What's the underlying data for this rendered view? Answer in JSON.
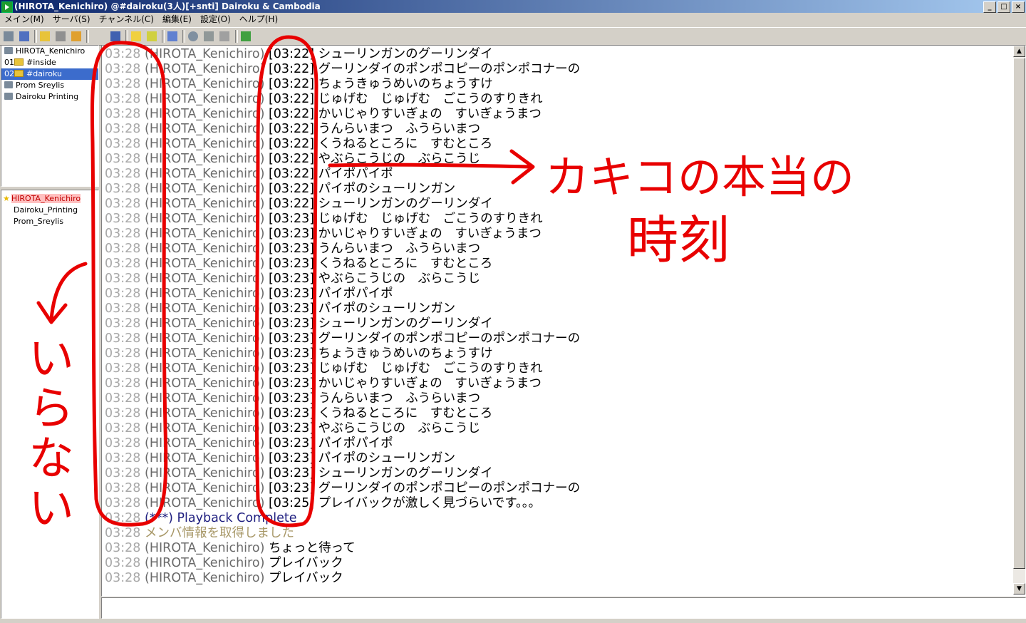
{
  "window": {
    "title": "(HIROTA_Kenichiro) @#dairoku(3人)[+snti] Dairoku & Cambodia",
    "controls": [
      "_",
      "□",
      "×"
    ]
  },
  "menu": [
    "メイン(M)",
    "サーバ(S)",
    "チャンネル(C)",
    "編集(E)",
    "設定(O)",
    "ヘルプ(H)"
  ],
  "channels": [
    {
      "num": "",
      "name": "HIROTA_Kenichiro",
      "kind": "server",
      "selected": false
    },
    {
      "num": "01",
      "name": "#inside",
      "kind": "channel",
      "selected": false
    },
    {
      "num": "02",
      "name": "#dairoku",
      "kind": "channel",
      "selected": true
    },
    {
      "num": "",
      "name": "Prom Sreylis",
      "kind": "server",
      "selected": false
    },
    {
      "num": "",
      "name": "Dairoku Printing",
      "kind": "server",
      "selected": false
    }
  ],
  "users": [
    {
      "name": "HIROTA_Kenichiro",
      "op": true
    },
    {
      "name": "Dairoku_Printing",
      "op": false
    },
    {
      "name": "Prom_Sreylis",
      "op": false
    }
  ],
  "log": [
    {
      "time": "03:28",
      "nick": "(HIROTA_Kenichiro)",
      "text": " [03:22] シューリンガンのグーリンダイ"
    },
    {
      "time": "03:28",
      "nick": "(HIROTA_Kenichiro)",
      "text": " [03:22] グーリンダイのポンポコピーのポンポコナーの"
    },
    {
      "time": "03:28",
      "nick": "(HIROTA_Kenichiro)",
      "text": " [03:22] ちょうきゅうめいのちょうすけ"
    },
    {
      "time": "03:28",
      "nick": "(HIROTA_Kenichiro)",
      "text": " [03:22] じゅげむ　じゅげむ　ごこうのすりきれ"
    },
    {
      "time": "03:28",
      "nick": "(HIROTA_Kenichiro)",
      "text": " [03:22] かいじゃりすいぎょの　すいぎょうまつ"
    },
    {
      "time": "03:28",
      "nick": "(HIROTA_Kenichiro)",
      "text": " [03:22] うんらいまつ　ふうらいまつ"
    },
    {
      "time": "03:28",
      "nick": "(HIROTA_Kenichiro)",
      "text": " [03:22] くうねるところに　すむところ"
    },
    {
      "time": "03:28",
      "nick": "(HIROTA_Kenichiro)",
      "text": " [03:22] やぶらこうじの　ぶらこうじ"
    },
    {
      "time": "03:28",
      "nick": "(HIROTA_Kenichiro)",
      "text": " [03:22] パイポパイポ"
    },
    {
      "time": "03:28",
      "nick": "(HIROTA_Kenichiro)",
      "text": " [03:22] パイポのシューリンガン"
    },
    {
      "time": "03:28",
      "nick": "(HIROTA_Kenichiro)",
      "text": " [03:22] シューリンガンのグーリンダイ"
    },
    {
      "time": "03:28",
      "nick": "(HIROTA_Kenichiro)",
      "text": " [03:23] じゅげむ　じゅげむ　ごこうのすりきれ"
    },
    {
      "time": "03:28",
      "nick": "(HIROTA_Kenichiro)",
      "text": " [03:23] かいじゃりすいぎょの　すいぎょうまつ"
    },
    {
      "time": "03:28",
      "nick": "(HIROTA_Kenichiro)",
      "text": " [03:23] うんらいまつ　ふうらいまつ"
    },
    {
      "time": "03:28",
      "nick": "(HIROTA_Kenichiro)",
      "text": " [03:23] くうねるところに　すむところ"
    },
    {
      "time": "03:28",
      "nick": "(HIROTA_Kenichiro)",
      "text": " [03:23] やぶらこうじの　ぶらこうじ"
    },
    {
      "time": "03:28",
      "nick": "(HIROTA_Kenichiro)",
      "text": " [03:23] パイポパイポ"
    },
    {
      "time": "03:28",
      "nick": "(HIROTA_Kenichiro)",
      "text": " [03:23] パイポのシューリンガン"
    },
    {
      "time": "03:28",
      "nick": "(HIROTA_Kenichiro)",
      "text": " [03:23] シューリンガンのグーリンダイ"
    },
    {
      "time": "03:28",
      "nick": "(HIROTA_Kenichiro)",
      "text": " [03:23] グーリンダイのポンポコピーのポンポコナーの"
    },
    {
      "time": "03:28",
      "nick": "(HIROTA_Kenichiro)",
      "text": " [03:23] ちょうきゅうめいのちょうすけ"
    },
    {
      "time": "03:28",
      "nick": "(HIROTA_Kenichiro)",
      "text": " [03:23] じゅげむ　じゅげむ　ごこうのすりきれ"
    },
    {
      "time": "03:28",
      "nick": "(HIROTA_Kenichiro)",
      "text": " [03:23] かいじゃりすいぎょの　すいぎょうまつ"
    },
    {
      "time": "03:28",
      "nick": "(HIROTA_Kenichiro)",
      "text": " [03:23] うんらいまつ　ふうらいまつ"
    },
    {
      "time": "03:28",
      "nick": "(HIROTA_Kenichiro)",
      "text": " [03:23] くうねるところに　すむところ"
    },
    {
      "time": "03:28",
      "nick": "(HIROTA_Kenichiro)",
      "text": " [03:23] やぶらこうじの　ぶらこうじ"
    },
    {
      "time": "03:28",
      "nick": "(HIROTA_Kenichiro)",
      "text": " [03:23] パイポパイポ"
    },
    {
      "time": "03:28",
      "nick": "(HIROTA_Kenichiro)",
      "text": " [03:23] パイポのシューリンガン"
    },
    {
      "time": "03:28",
      "nick": "(HIROTA_Kenichiro)",
      "text": " [03:23] シューリンガンのグーリンダイ"
    },
    {
      "time": "03:28",
      "nick": "(HIROTA_Kenichiro)",
      "text": " [03:23] グーリンダイのポンポコピーのポンポコナーの"
    },
    {
      "time": "03:28",
      "nick": "(HIROTA_Kenichiro)",
      "text": " [03:25] プレイバックが激しく見づらいです。。。"
    },
    {
      "time": "03:28",
      "nick": "(***)",
      "text": " Playback Complete",
      "type": "playback"
    },
    {
      "time": "03:28",
      "nick": "",
      "text": " メンバ情報を取得しました",
      "type": "system"
    },
    {
      "time": "03:28",
      "nick": "(HIROTA_Kenichiro)",
      "text": " ちょっと待って"
    },
    {
      "time": "03:28",
      "nick": "(HIROTA_Kenichiro)",
      "text": " プレイバック"
    },
    {
      "time": "03:28",
      "nick": "(HIROTA_Kenichiro)",
      "text": " プレイバック"
    }
  ],
  "annotations": {
    "right_label_line1": "カキコの本当の",
    "right_label_line2": "時刻",
    "left_label": "いらない",
    "color": "#e80000"
  },
  "colors": {
    "titlebar_start": "#0a246a",
    "titlebar_end": "#a6caf0",
    "selection": "#3c6ccc",
    "annotation": "#e80000"
  }
}
